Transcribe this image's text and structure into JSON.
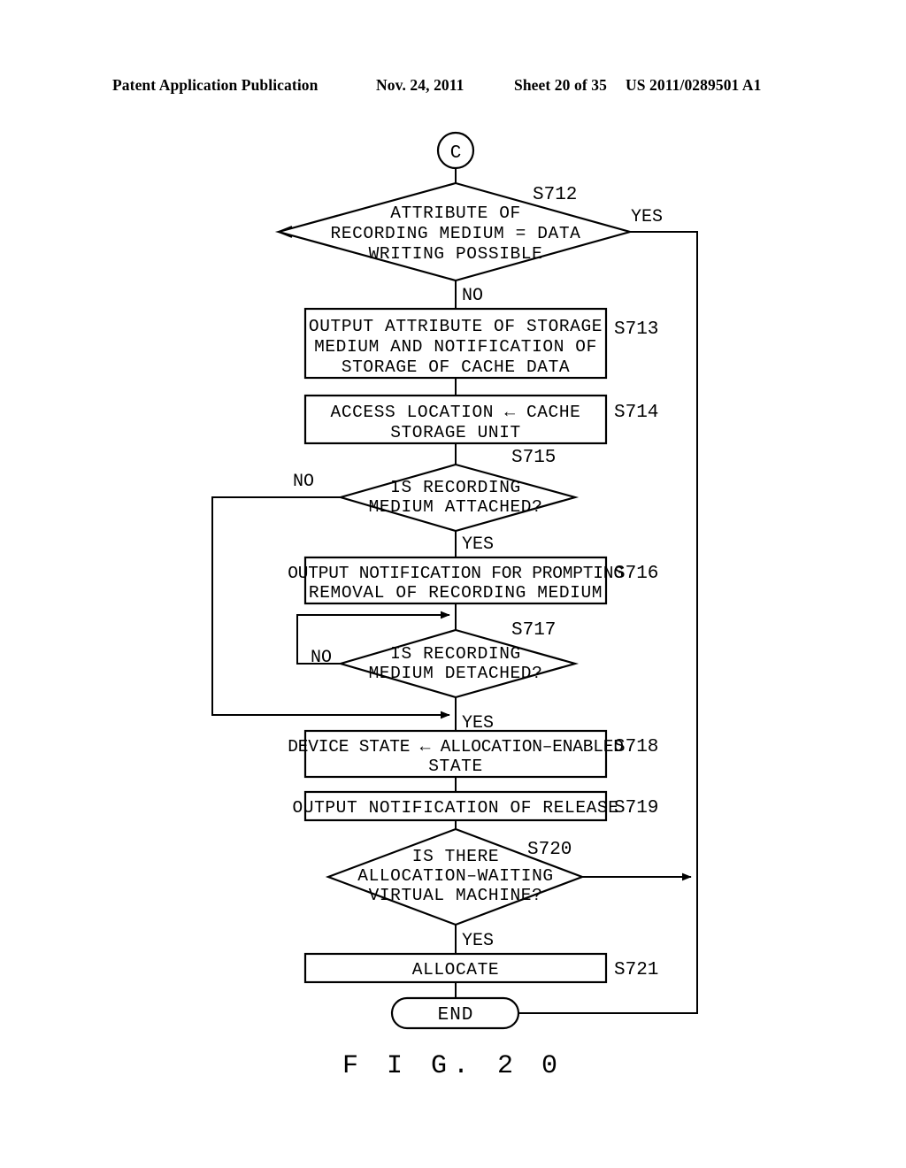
{
  "header": {
    "publication": "Patent Application Publication",
    "date": "Nov. 24, 2011",
    "sheet": "Sheet 20 of 35",
    "patent_number": "US 2011/0289501 A1"
  },
  "figure": {
    "caption": "F I G.  2 0"
  },
  "flowchart": {
    "connector_in": {
      "label": "C"
    },
    "terminal_end": {
      "label": "END"
    },
    "nodes": [
      {
        "id": "S712",
        "type": "decision",
        "step": "S712",
        "lines": [
          "ATTRIBUTE OF",
          "RECORDING MEDIUM = DATA",
          "WRITING POSSIBLE"
        ],
        "yes_label": "YES",
        "no_label": "NO"
      },
      {
        "id": "S713",
        "type": "process",
        "step": "S713",
        "lines": [
          "OUTPUT ATTRIBUTE OF STORAGE",
          "MEDIUM AND NOTIFICATION OF",
          "STORAGE OF CACHE DATA"
        ]
      },
      {
        "id": "S714",
        "type": "process",
        "step": "S714",
        "lines": [
          "ACCESS LOCATION ← CACHE",
          "STORAGE UNIT"
        ]
      },
      {
        "id": "S715",
        "type": "decision",
        "step": "S715",
        "lines": [
          "IS RECORDING",
          "MEDIUM ATTACHED?"
        ],
        "yes_label": "YES",
        "no_label": "NO"
      },
      {
        "id": "S716",
        "type": "process",
        "step": "S716",
        "lines": [
          "OUTPUT NOTIFICATION FOR PROMPTING",
          "REMOVAL OF RECORDING MEDIUM"
        ]
      },
      {
        "id": "S717",
        "type": "decision",
        "step": "S717",
        "lines": [
          "IS RECORDING",
          "MEDIUM DETACHED?"
        ],
        "yes_label": "YES",
        "no_label": "NO"
      },
      {
        "id": "S718",
        "type": "process",
        "step": "S718",
        "lines": [
          "DEVICE STATE ← ALLOCATION–ENABLED",
          "STATE"
        ]
      },
      {
        "id": "S719",
        "type": "process",
        "step": "S719",
        "lines": [
          "OUTPUT NOTIFICATION OF RELEASE"
        ]
      },
      {
        "id": "S720",
        "type": "decision",
        "step": "S720",
        "lines": [
          "IS THERE",
          "ALLOCATION–WAITING",
          "VIRTUAL MACHINE?"
        ],
        "yes_label": "YES",
        "no_label": ""
      },
      {
        "id": "S721",
        "type": "process",
        "step": "S721",
        "lines": [
          "ALLOCATE"
        ]
      }
    ]
  }
}
